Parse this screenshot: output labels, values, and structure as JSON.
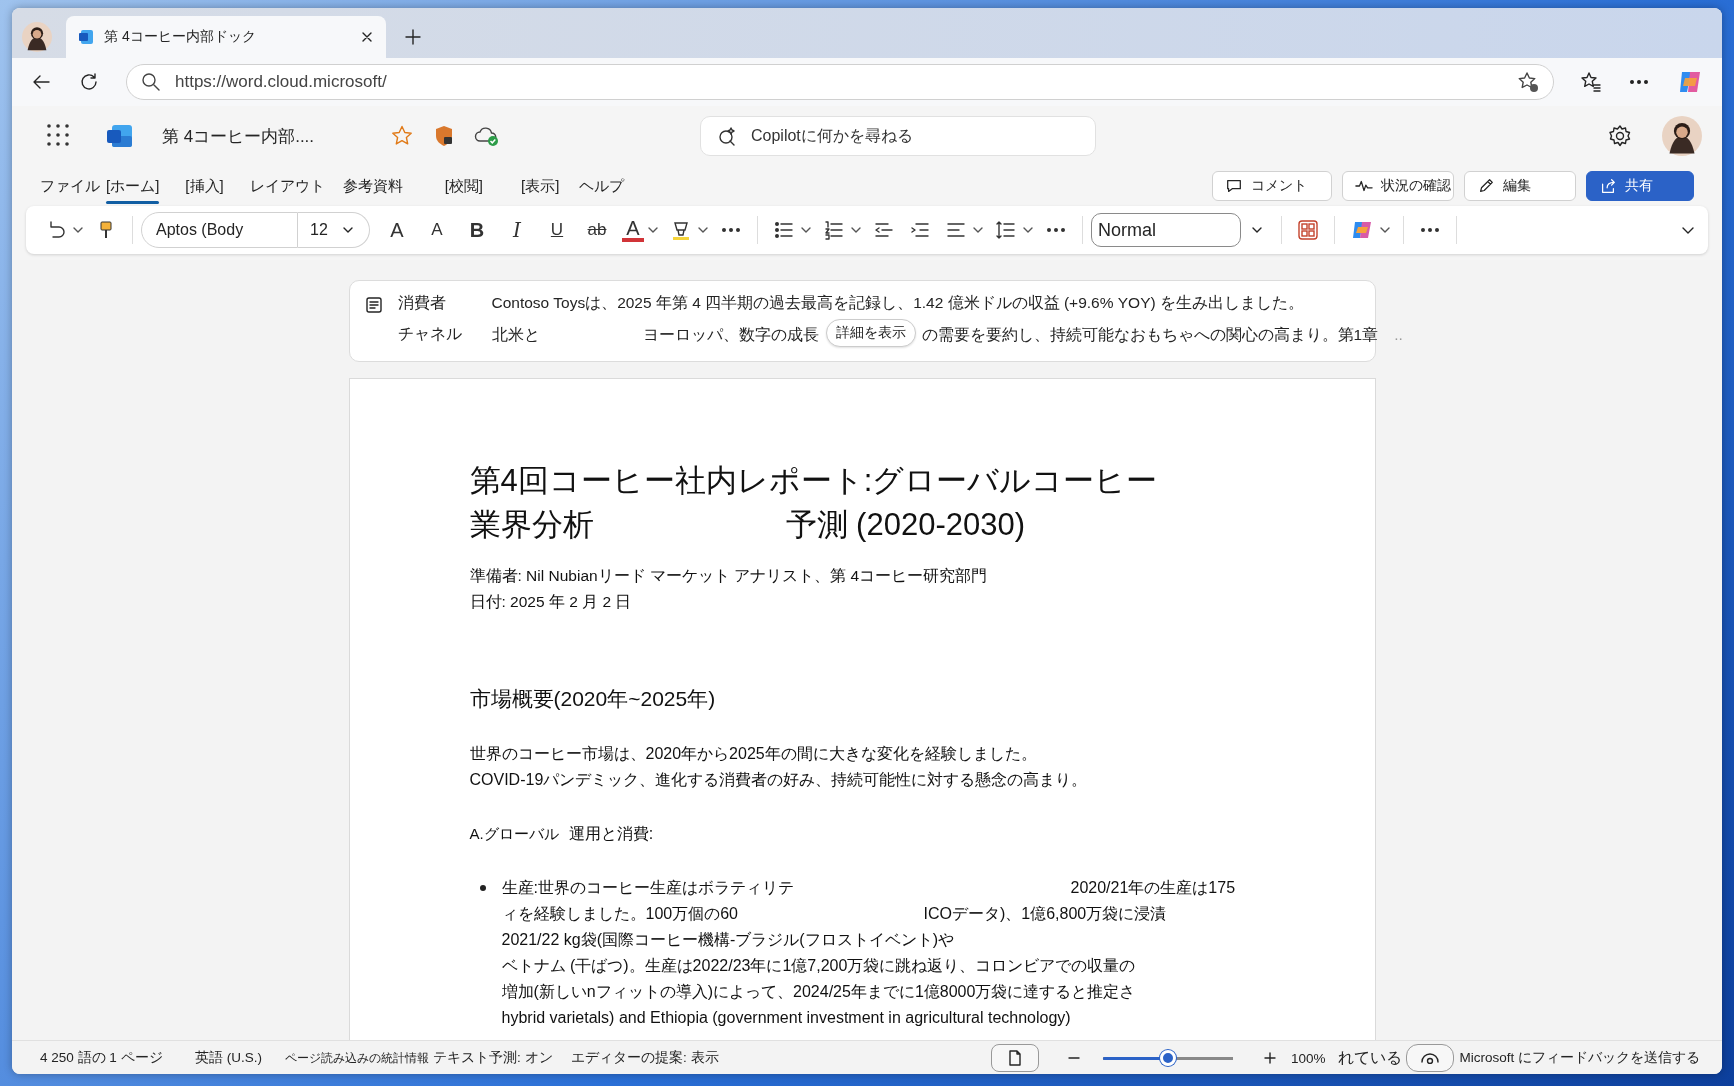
{
  "browser": {
    "tab_title": "第 4コーヒー内部ドック",
    "url": "https://word.cloud.microsoft/"
  },
  "app": {
    "doc_title": "第 4コーヒー内部....",
    "search_placeholder": "Copilotに何かを尋ねる"
  },
  "ribbon": {
    "tabs": [
      {
        "label": "ファイル",
        "selected": false
      },
      {
        "label": "[ホーム]",
        "selected": true
      },
      {
        "label": "[挿入]",
        "selected": false
      },
      {
        "label": "レイアウト",
        "selected": false
      },
      {
        "label": "参考資料",
        "selected": false
      },
      {
        "label": "[校閲]",
        "selected": false
      },
      {
        "label": "[表示]",
        "selected": false
      },
      {
        "label": "ヘルプ",
        "selected": false
      }
    ],
    "actions": [
      {
        "label": "コメント",
        "kind": "comment"
      },
      {
        "label": "状況の確認",
        "kind": "catchup"
      },
      {
        "label": "編集",
        "kind": "edit"
      },
      {
        "label": "共有",
        "kind": "share"
      }
    ]
  },
  "toolbar": {
    "font": "Aptos (Body",
    "size": "12",
    "grow": "A",
    "shrink": "A",
    "bold": "B",
    "italic": "I",
    "underline": "U",
    "strike": "ab",
    "font_color": "A",
    "style": "Normal"
  },
  "summary": {
    "labels": [
      "消費者",
      "チャネル"
    ],
    "line_1": "Contoso Toysは、2025 年第 4 四半期の過去最高を記録し、1.42 億米ドルの収益 (+9.6% YOY) を生み出しました。",
    "line_2": [
      "北米と",
      "ヨーロッパ、数字の成長"
    ],
    "button": "詳細を表示",
    "line_2_rest": "の需要を要約し、持続可能なおもちゃへの関心の高まり。第1章",
    "ellipsis": ".."
  },
  "document": {
    "title_line_1": "第4回コーヒー社内レポート:グローバルコーヒー",
    "title_line_2": [
      "業界分析",
      "予測 (2020-2030)"
    ],
    "author": "準備者: Nil Nubianリード マーケット アナリスト、第 4コーヒー研究部門",
    "date": "日付: 2025 年 2 月 2 日",
    "heading": "市場概要(2020年~2025年)",
    "intro": [
      "世界のコーヒー市場は、2020年から2025年の間に大きな変化を経験しました。",
      "COVID-19パンデミック、進化する消費者の好み、持続可能性に対する懸念の高まり。"
    ],
    "subheading": [
      "A.グローバル",
      "運用と消費:"
    ],
    "bullet_lines": [
      [
        "生産:世界のコーヒー生産はボラティリテ",
        "2020/21年の生産は175"
      ],
      [
        "ィを経験しました。100万個の60",
        "ICOデータ)、1億6,800万袋に浸漬"
      ],
      [
        "2021/22 kg袋(国際コーヒー機構-ブラジル(フロストイベント)や"
      ],
      [
        "ベトナム (干ばつ)。生産は2022/23年に1億7,200万袋に跳ね返り、コロンビアでの収量の"
      ],
      [
        "増加(新しいnフィットの導入)によって、2024/25年までに1億8000万袋に達すると推定さ"
      ],
      [
        "hybrid varietals) and Ethiopia (government investment in agricultural technology)"
      ]
    ]
  },
  "status_bar": {
    "words": "4 250 語の 1 ページ",
    "language": "英語 (U.S.)",
    "stats": "ページ読み込みの統計情報",
    "prediction": "テキスト予測: オン",
    "editor": "エディターの提案: 表示",
    "zoom": {
      "level": 0.5,
      "percent": "100%"
    },
    "overlap_text": "れている",
    "feedback": "Microsoft にフィードバックを送信する"
  }
}
